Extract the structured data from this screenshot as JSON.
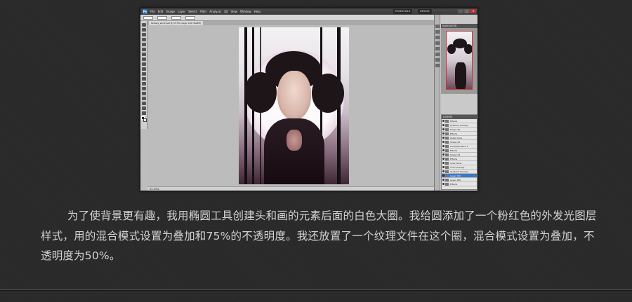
{
  "screenshot": {
    "app_logo": "Ps",
    "menus": [
      "File",
      "Edit",
      "Image",
      "Layer",
      "Select",
      "Filter",
      "Analysis",
      "3D",
      "View",
      "Window",
      "Help"
    ],
    "workspace_buttons": [
      "ESSENTIALS",
      "DESIGN"
    ],
    "window_controls": [
      "–",
      "□",
      "×"
    ],
    "document_tab": "fantasy_stock.psd @ 33.3% (Layer 190, RGB/8)",
    "status_text": "33.33%",
    "navigator_title": "NAVIGATOR",
    "layers_title": "LAYERS",
    "layers": [
      {
        "name": "Effects",
        "selected": false
      },
      {
        "name": "Gradient Overlay",
        "selected": false
      },
      {
        "name": "Shape 95",
        "selected": false
      },
      {
        "name": "Effects",
        "selected": false
      },
      {
        "name": "Outer Glow",
        "selected": false
      },
      {
        "name": "Shape 93",
        "selected": false
      },
      {
        "name": "Hue/Saturation 1",
        "selected": false
      },
      {
        "name": "Effects",
        "selected": false
      },
      {
        "name": "Shape 94",
        "selected": false
      },
      {
        "name": "Effects",
        "selected": false
      },
      {
        "name": "Inner Glow",
        "selected": false
      },
      {
        "name": "Color Overlay",
        "selected": false
      },
      {
        "name": "Gradient Overlay",
        "selected": false
      },
      {
        "name": "Layer 190",
        "selected": true
      },
      {
        "name": "Layer 189",
        "selected": false
      },
      {
        "name": "Effects",
        "selected": false
      }
    ]
  },
  "caption": {
    "text": "为了使背景更有趣，我用椭圆工具创建头和画的元素后面的白色大圈。我给圆添加了一个粉红色的外发光图层样式，用的混合模式设置为叠加和75%的不透明度。我还放置了一个纹理文件在这个圈，混合模式设置为叠加，不透明度为50%。"
  },
  "colors": {
    "page_bg": "#2a2a2a",
    "caption_text": "#d2d2d2",
    "selected_layer": "#3b78c7"
  }
}
